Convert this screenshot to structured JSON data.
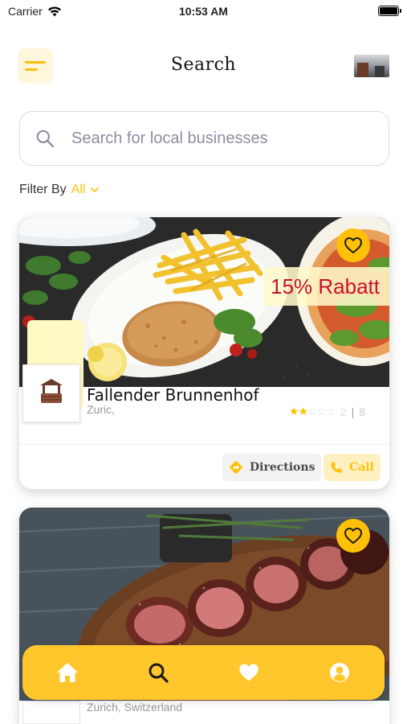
{
  "status_bar": {
    "carrier": "Carrier",
    "time": "10:53 AM"
  },
  "header": {
    "title": "Search"
  },
  "search": {
    "placeholder": "Search for local businesses"
  },
  "filter": {
    "label": "Filter By",
    "value": "All"
  },
  "listings": [
    {
      "name": "Fallender Brunnenhof",
      "location": "Zuric,",
      "promo": "15% Rabatt",
      "rating": 2,
      "rating_max": 5,
      "rating_value": "2",
      "reviews": "8",
      "directions_label": "Directions",
      "call_label": "Call"
    },
    {
      "location": "Zurich, Switzerland"
    }
  ],
  "tabbar": {
    "items": [
      "home",
      "search",
      "favorites",
      "profile"
    ]
  },
  "colors": {
    "accent": "#ffc107",
    "promo_text": "#c8102e"
  }
}
